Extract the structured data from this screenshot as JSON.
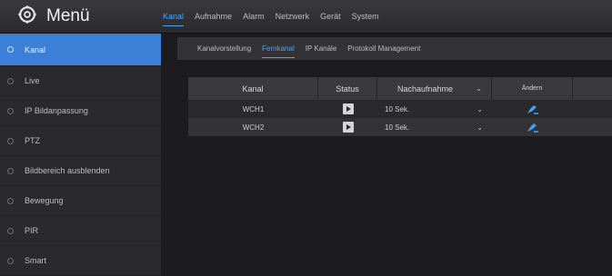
{
  "header": {
    "title": "Menü",
    "gear_icon": "gear-icon",
    "tabs": [
      {
        "label": "Kanal",
        "active": true
      },
      {
        "label": "Aufnahme",
        "active": false
      },
      {
        "label": "Alarm",
        "active": false
      },
      {
        "label": "Netzwerk",
        "active": false
      },
      {
        "label": "Gerät",
        "active": false
      },
      {
        "label": "System",
        "active": false
      }
    ]
  },
  "sidebar": {
    "items": [
      {
        "label": "Kanal",
        "active": true
      },
      {
        "label": "Live",
        "active": false
      },
      {
        "label": "IP Bildanpassung",
        "active": false
      },
      {
        "label": "PTZ",
        "active": false
      },
      {
        "label": "Bildbereich ausblenden",
        "active": false
      },
      {
        "label": "Bewegung",
        "active": false
      },
      {
        "label": "PIR",
        "active": false
      },
      {
        "label": "Smart",
        "active": false
      }
    ]
  },
  "subtabs": [
    {
      "label": "Kanalvorstellung",
      "active": false
    },
    {
      "label": "Fernkanal",
      "active": true
    },
    {
      "label": "IP Kanäle",
      "active": false
    },
    {
      "label": "Protokoll Management",
      "active": false
    }
  ],
  "table": {
    "headers": {
      "kanal": "Kanal",
      "status": "Status",
      "nachaufnahme": "Nachaufnahme",
      "edit": "Ändern"
    },
    "rows": [
      {
        "kanal": "WCH1",
        "nachaufnahme": "10 Sek."
      },
      {
        "kanal": "WCH2",
        "nachaufnahme": "10 Sek."
      }
    ]
  },
  "colors": {
    "accent": "#4aa3ff",
    "sidebar_active": "#3b7fd6",
    "edit_icon": "#3fa0ff"
  }
}
